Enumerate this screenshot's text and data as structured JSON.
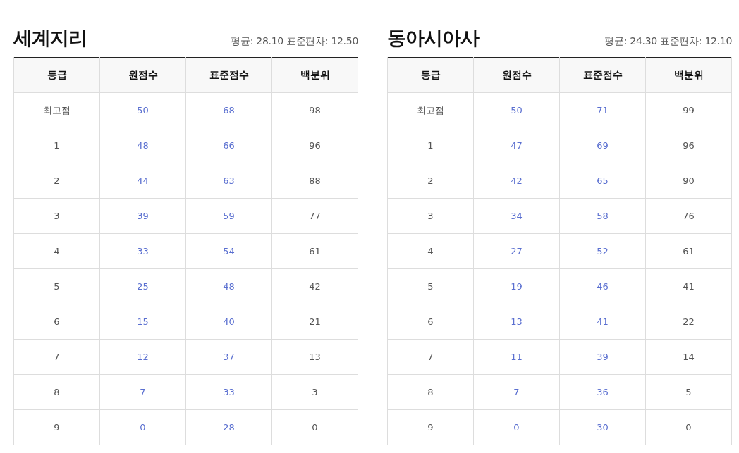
{
  "panels": [
    {
      "title": "세계지리",
      "stats": "평균: 28.10 표준편차: 12.50",
      "columns": [
        "등급",
        "원점수",
        "표준점수",
        "백분위"
      ],
      "rows": [
        [
          "최고점",
          "50",
          "68",
          "98"
        ],
        [
          "1",
          "48",
          "66",
          "96"
        ],
        [
          "2",
          "44",
          "63",
          "88"
        ],
        [
          "3",
          "39",
          "59",
          "77"
        ],
        [
          "4",
          "33",
          "54",
          "61"
        ],
        [
          "5",
          "25",
          "48",
          "42"
        ],
        [
          "6",
          "15",
          "40",
          "21"
        ],
        [
          "7",
          "12",
          "37",
          "13"
        ],
        [
          "8",
          "7",
          "33",
          "3"
        ],
        [
          "9",
          "0",
          "28",
          "0"
        ]
      ]
    },
    {
      "title": "동아시아사",
      "stats": "평균: 24.30 표준편차: 12.10",
      "columns": [
        "등급",
        "원점수",
        "표준점수",
        "백분위"
      ],
      "rows": [
        [
          "최고점",
          "50",
          "71",
          "99"
        ],
        [
          "1",
          "47",
          "69",
          "96"
        ],
        [
          "2",
          "42",
          "65",
          "90"
        ],
        [
          "3",
          "34",
          "58",
          "76"
        ],
        [
          "4",
          "27",
          "52",
          "61"
        ],
        [
          "5",
          "19",
          "46",
          "41"
        ],
        [
          "6",
          "13",
          "41",
          "22"
        ],
        [
          "7",
          "11",
          "39",
          "14"
        ],
        [
          "8",
          "7",
          "36",
          "5"
        ],
        [
          "9",
          "0",
          "30",
          "0"
        ]
      ]
    }
  ]
}
